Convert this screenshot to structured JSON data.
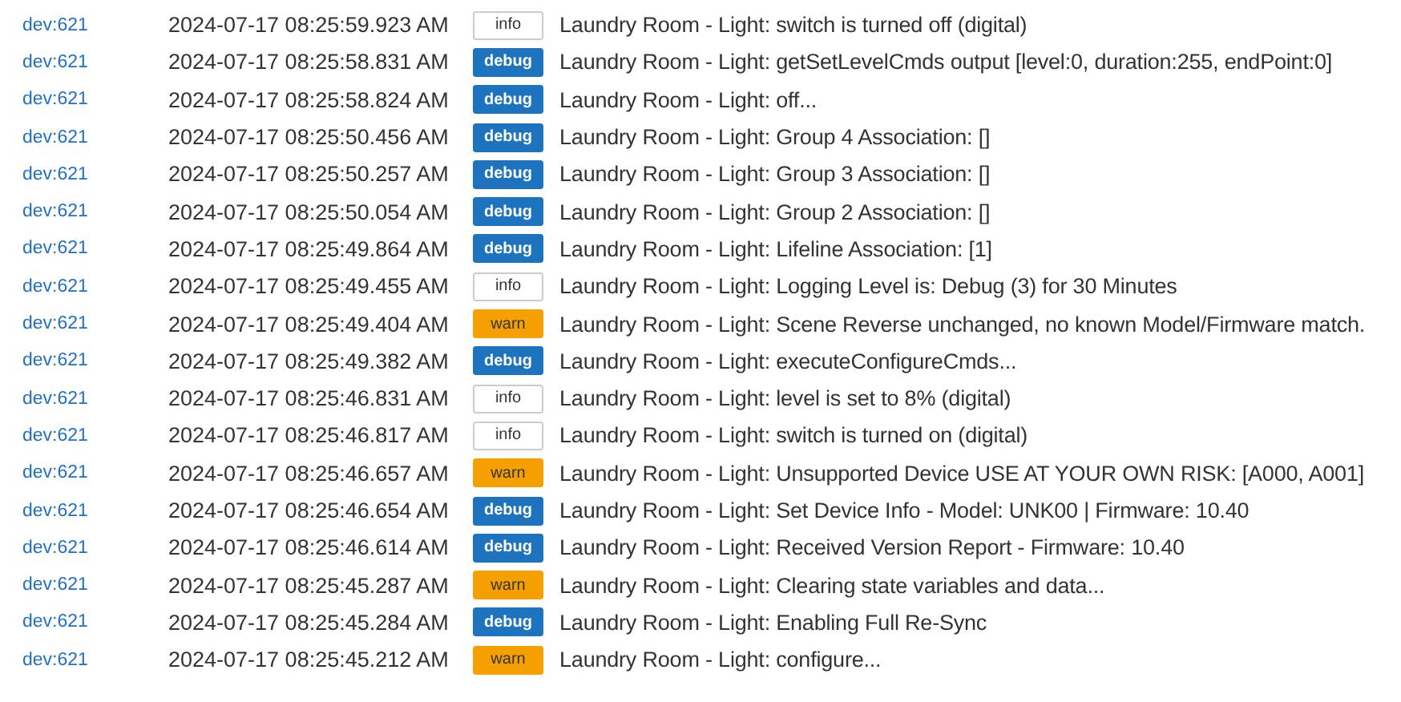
{
  "log": [
    {
      "device": "dev:621",
      "time": "2024-07-17 08:25:59.923 AM",
      "level": "info",
      "message": "Laundry Room - Light: switch is turned off (digital)"
    },
    {
      "device": "dev:621",
      "time": "2024-07-17 08:25:58.831 AM",
      "level": "debug",
      "message": "Laundry Room - Light: getSetLevelCmds output [level:0, duration:255, endPoint:0]"
    },
    {
      "device": "dev:621",
      "time": "2024-07-17 08:25:58.824 AM",
      "level": "debug",
      "message": "Laundry Room - Light: off..."
    },
    {
      "device": "dev:621",
      "time": "2024-07-17 08:25:50.456 AM",
      "level": "debug",
      "message": "Laundry Room - Light: Group 4 Association: []"
    },
    {
      "device": "dev:621",
      "time": "2024-07-17 08:25:50.257 AM",
      "level": "debug",
      "message": "Laundry Room - Light: Group 3 Association: []"
    },
    {
      "device": "dev:621",
      "time": "2024-07-17 08:25:50.054 AM",
      "level": "debug",
      "message": "Laundry Room - Light: Group 2 Association: []"
    },
    {
      "device": "dev:621",
      "time": "2024-07-17 08:25:49.864 AM",
      "level": "debug",
      "message": "Laundry Room - Light: Lifeline Association: [1]"
    },
    {
      "device": "dev:621",
      "time": "2024-07-17 08:25:49.455 AM",
      "level": "info",
      "message": "Laundry Room - Light: Logging Level is: Debug (3) for 30 Minutes"
    },
    {
      "device": "dev:621",
      "time": "2024-07-17 08:25:49.404 AM",
      "level": "warn",
      "message": "Laundry Room - Light: Scene Reverse unchanged, no known Model/Firmware match."
    },
    {
      "device": "dev:621",
      "time": "2024-07-17 08:25:49.382 AM",
      "level": "debug",
      "message": "Laundry Room - Light: executeConfigureCmds..."
    },
    {
      "device": "dev:621",
      "time": "2024-07-17 08:25:46.831 AM",
      "level": "info",
      "message": "Laundry Room - Light: level is set to 8% (digital)"
    },
    {
      "device": "dev:621",
      "time": "2024-07-17 08:25:46.817 AM",
      "level": "info",
      "message": "Laundry Room - Light: switch is turned on (digital)"
    },
    {
      "device": "dev:621",
      "time": "2024-07-17 08:25:46.657 AM",
      "level": "warn",
      "message": "Laundry Room - Light: Unsupported Device USE AT YOUR OWN RISK: [A000, A001]"
    },
    {
      "device": "dev:621",
      "time": "2024-07-17 08:25:46.654 AM",
      "level": "debug",
      "message": "Laundry Room - Light: Set Device Info - Model: UNK00 | Firmware: 10.40"
    },
    {
      "device": "dev:621",
      "time": "2024-07-17 08:25:46.614 AM",
      "level": "debug",
      "message": "Laundry Room - Light: Received Version Report - Firmware: 10.40"
    },
    {
      "device": "dev:621",
      "time": "2024-07-17 08:25:45.287 AM",
      "level": "warn",
      "message": "Laundry Room - Light: Clearing state variables and data..."
    },
    {
      "device": "dev:621",
      "time": "2024-07-17 08:25:45.284 AM",
      "level": "debug",
      "message": "Laundry Room - Light: Enabling Full Re-Sync"
    },
    {
      "device": "dev:621",
      "time": "2024-07-17 08:25:45.212 AM",
      "level": "warn",
      "message": "Laundry Room - Light: configure..."
    }
  ]
}
